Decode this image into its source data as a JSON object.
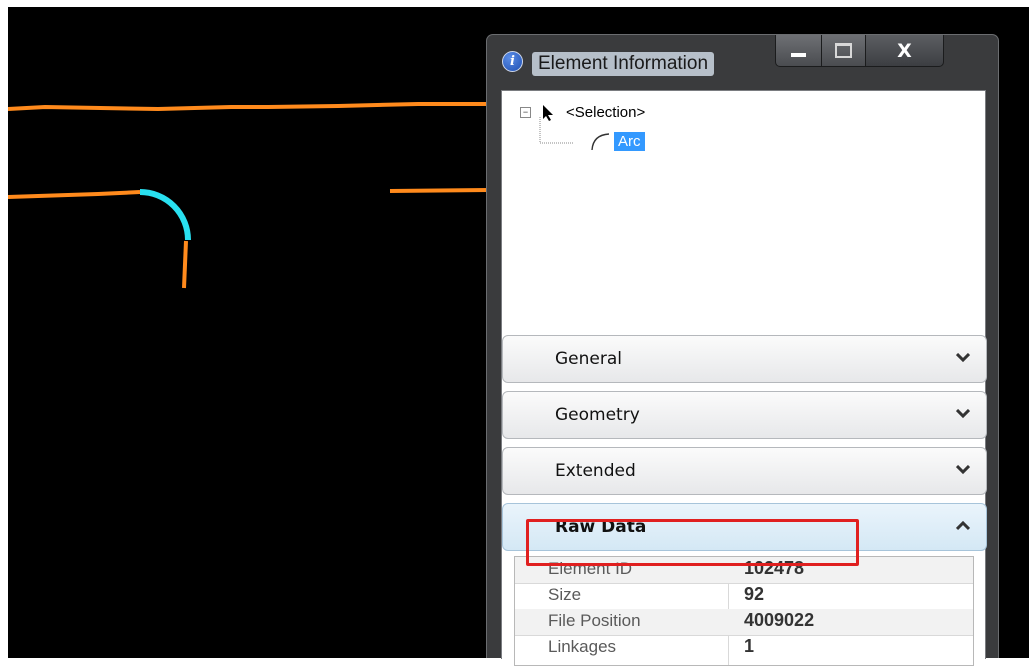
{
  "window": {
    "title": "Element Information",
    "buttons": {
      "minimize": "minimize",
      "maximize": "maximize",
      "close": "X"
    }
  },
  "tree": {
    "root_label": "<Selection>",
    "child_label": "Arc"
  },
  "panels": [
    {
      "label": "General",
      "state": "collapsed"
    },
    {
      "label": "Geometry",
      "state": "collapsed"
    },
    {
      "label": "Extended",
      "state": "collapsed"
    },
    {
      "label": "Raw Data",
      "state": "expanded"
    }
  ],
  "raw_data": {
    "rows": [
      {
        "key": "Element ID",
        "value": "102478"
      },
      {
        "key": "Size",
        "value": "92"
      },
      {
        "key": "File Position",
        "value": "4009022"
      },
      {
        "key": "Linkages",
        "value": "1"
      }
    ]
  },
  "colors": {
    "canvas": "#000000",
    "element_line": "#ff8a1c",
    "selected_arc": "#29e0f0",
    "highlight_box": "#e02020",
    "tree_selection": "#3399ff"
  },
  "icons": {
    "window": "info-icon",
    "tree_root": "cursor-arrow-icon",
    "tree_child": "arc-icon",
    "collapsed_chevron": "chevron-down-icon",
    "expanded_chevron": "chevron-up-icon"
  }
}
